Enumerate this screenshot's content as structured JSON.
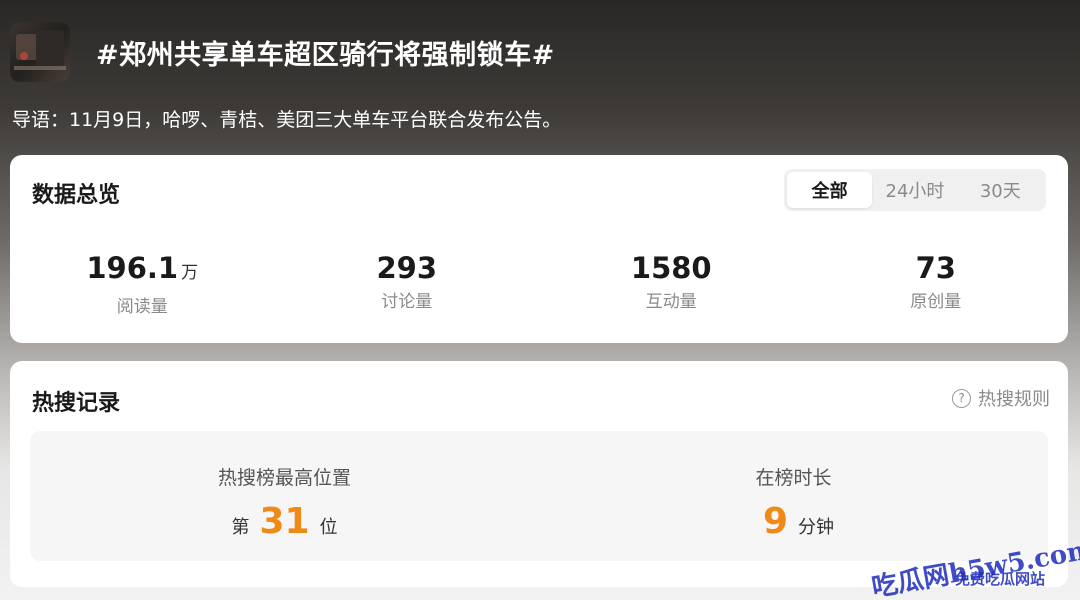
{
  "header": {
    "title": "#郑州共享单车超区骑行将强制锁车#"
  },
  "intro": "导语：11月9日，哈啰、青桔、美团三大单车平台联合发布公告。",
  "overview": {
    "title": "数据总览",
    "tabs": [
      {
        "label": "全部",
        "active": true
      },
      {
        "label": "24小时",
        "active": false
      },
      {
        "label": "30天",
        "active": false
      }
    ],
    "stats": [
      {
        "value": "196.1",
        "unit": "万",
        "label": "阅读量"
      },
      {
        "value": "293",
        "unit": "",
        "label": "讨论量"
      },
      {
        "value": "1580",
        "unit": "",
        "label": "互动量"
      },
      {
        "value": "73",
        "unit": "",
        "label": "原创量"
      }
    ]
  },
  "hot": {
    "title": "热搜记录",
    "rules_icon": "?",
    "rules_label": "热搜规则",
    "best_rank": {
      "label": "热搜榜最高位置",
      "prefix": "第",
      "value": "31",
      "suffix": "位"
    },
    "duration": {
      "label": "在榜时长",
      "value": "9",
      "suffix": "分钟"
    }
  },
  "watermark": {
    "line1": "吃瓜网h5w5.com",
    "line2": "免费吃瓜网站"
  },
  "colors": {
    "accent": "#f08a16",
    "watermark": "#1f2dbd"
  }
}
